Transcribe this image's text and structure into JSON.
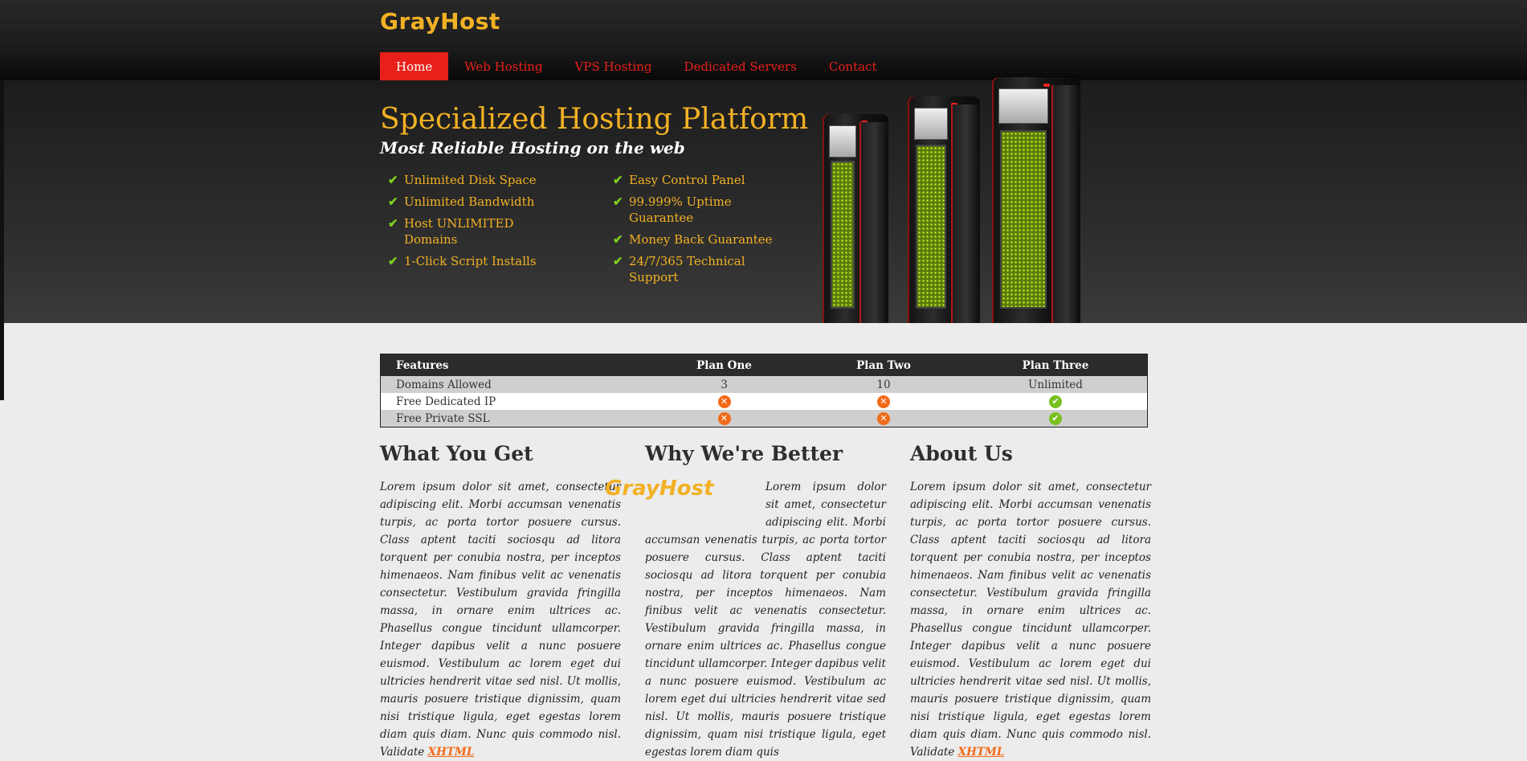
{
  "brand": {
    "logo": "GrayHost"
  },
  "nav": [
    {
      "label": "Home",
      "active": true
    },
    {
      "label": "Web Hosting"
    },
    {
      "label": "VPS Hosting"
    },
    {
      "label": "Dedicated Servers"
    },
    {
      "label": "Contact"
    }
  ],
  "hero": {
    "headline": "Specialized Hosting Platform",
    "subline": "Most Reliable Hosting on the web",
    "features_left": [
      "Unlimited Disk Space",
      "Unlimited Bandwidth",
      "Host UNLIMITED Domains",
      "1-Click Script Installs"
    ],
    "features_right": [
      "Easy Control Panel",
      "99.999% Uptime Guarantee",
      "Money Back Guarantee",
      "24/7/365 Technical Support"
    ],
    "check_icon": "✔"
  },
  "table": {
    "headers": [
      "Features",
      "Plan One",
      "Plan Two",
      "Plan Three"
    ],
    "rows": [
      {
        "feature": "Domains Allowed",
        "plan1": "3",
        "plan2": "10",
        "plan3": "Unlimited"
      },
      {
        "feature": "Free Dedicated IP",
        "plan1": "✕",
        "plan2": "✕",
        "plan3": "✔"
      },
      {
        "feature": "Free Private SSL",
        "plan1": "✕",
        "plan2": "✕",
        "plan3": "✔"
      }
    ]
  },
  "sections": [
    {
      "title": "What You Get",
      "body": "Lorem ipsum dolor sit amet, consectetur adipiscing elit. Morbi accumsan venenatis turpis, ac porta tortor posuere cursus. Class aptent taciti sociosqu ad litora torquent per conubia nostra, per inceptos himenaeos. Nam finibus velit ac venenatis consectetur. Vestibulum gravida fringilla massa, in ornare enim ultrices ac. Phasellus congue tincidunt ullamcorper. Integer dapibus velit a nunc posuere euismod. Vestibulum ac lorem eget dui ultricies hendrerit vitae sed nisl. Ut mollis, mauris posuere tristique dignissim, quam nisi tristique ligula, eget egestas lorem diam quis diam. Nunc quis commodo nisl. Validate ",
      "link": "XHTML"
    },
    {
      "title": "Why We're Better",
      "logo": "GrayHost",
      "body": "Lorem ipsum dolor sit amet, consectetur adipiscing elit. Morbi accumsan venenatis turpis, ac porta tortor posuere cursus. Class aptent taciti sociosqu ad litora torquent per conubia nostra, per inceptos himenaeos. Nam finibus velit ac venenatis consectetur. Vestibulum gravida fringilla massa, in ornare enim ultrices ac. Phasellus congue tincidunt ullamcorper. Integer dapibus velit a nunc posuere euismod. Vestibulum ac lorem eget dui ultricies hendrerit vitae sed nisl. Ut mollis, mauris posuere tristique dignissim, quam nisi tristique ligula, eget egestas lorem diam quis"
    },
    {
      "title": "About Us",
      "body": "Lorem ipsum dolor sit amet, consectetur adipiscing elit. Morbi accumsan venenatis turpis, ac porta tortor posuere cursus. Class aptent taciti sociosqu ad litora torquent per conubia nostra, per inceptos himenaeos. Nam finibus velit ac venenatis consectetur. Vestibulum gravida fringilla massa, in ornare enim ultrices ac. Phasellus congue tincidunt ullamcorper. Integer dapibus velit a nunc posuere euismod. Vestibulum ac lorem eget dui ultricies hendrerit vitae sed nisl. Ut mollis, mauris posuere tristique dignissim, quam nisi tristique ligula, eget egestas lorem diam quis diam. Nunc quis commodo nisl. Validate ",
      "link": "XHTML"
    }
  ],
  "colors": {
    "accent": "#f2b124",
    "nav_red": "#e8201a",
    "check_green": "#7fcf1f",
    "cross_orange": "#f26a17"
  }
}
